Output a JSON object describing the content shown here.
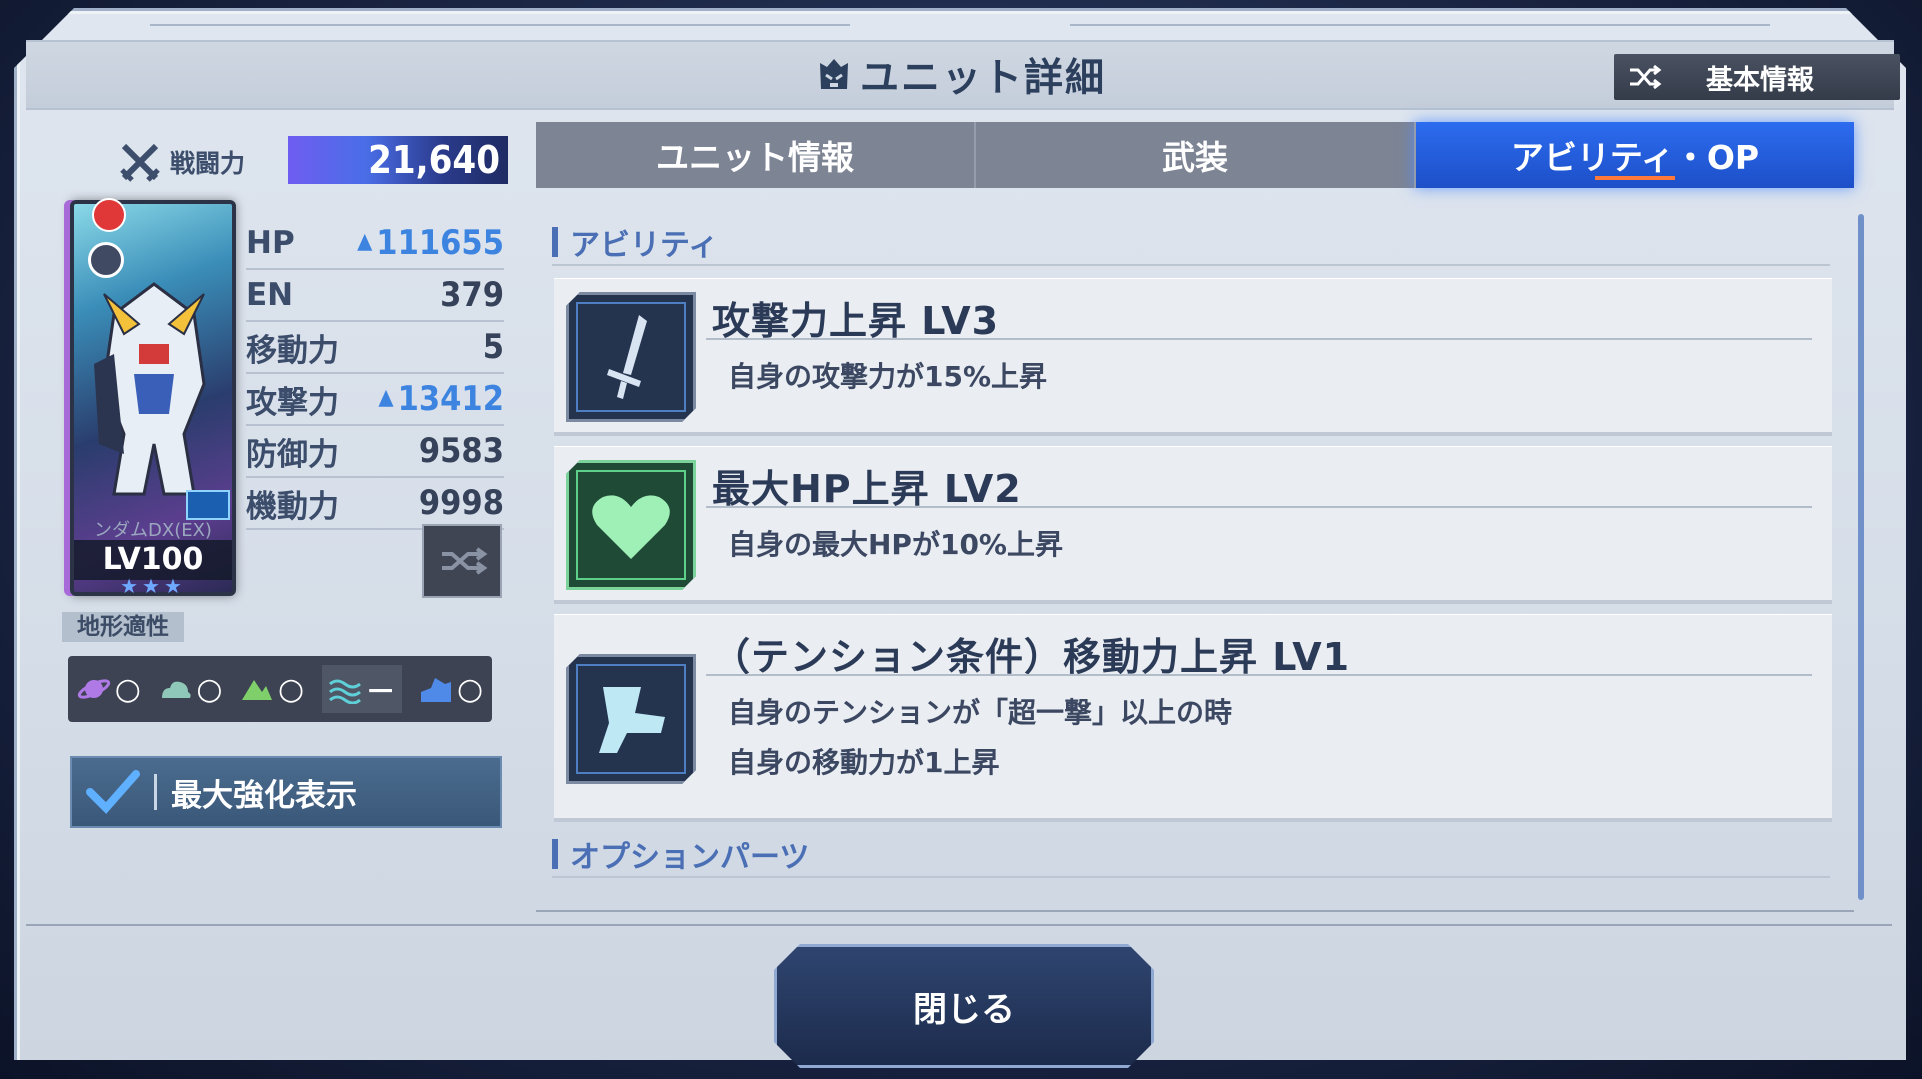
{
  "header": {
    "title": "ユニット詳細",
    "basic_info_button": "基本情報"
  },
  "left_panel": {
    "power_label": "戦闘力",
    "power_value": "21,640",
    "card": {
      "name": "ンダムDX(EX)",
      "level": "LV100",
      "stars": "★★★"
    },
    "stats": [
      {
        "label": "HP",
        "value": "111655",
        "boosted": true
      },
      {
        "label": "EN",
        "value": "379",
        "boosted": false
      },
      {
        "label": "移動力",
        "value": "5",
        "boosted": false
      },
      {
        "label": "攻撃力",
        "value": "13412",
        "boosted": true
      },
      {
        "label": "防御力",
        "value": "9583",
        "boosted": false
      },
      {
        "label": "機動力",
        "value": "9998",
        "boosted": false
      }
    ],
    "terrain_label": "地形適性",
    "terrain": [
      {
        "icon": "space-icon",
        "rating": "○"
      },
      {
        "icon": "air-icon",
        "rating": "○"
      },
      {
        "icon": "land-icon",
        "rating": "○"
      },
      {
        "icon": "water-icon",
        "rating": "－"
      },
      {
        "icon": "underground-icon",
        "rating": "○"
      }
    ],
    "max_enhance_label": "最大強化表示",
    "max_enhance_checked": true
  },
  "tabs": [
    {
      "label": "ユニット情報",
      "active": false
    },
    {
      "label": "武装",
      "active": false
    },
    {
      "label": "アビリティ・OP",
      "active": true
    }
  ],
  "abilities_section": "アビリティ",
  "abilities": [
    {
      "icon": "sword-icon",
      "name": "攻撃力上昇 LV3",
      "desc": [
        "自身の攻撃力が15%上昇"
      ]
    },
    {
      "icon": "heart-icon",
      "name": "最大HP上昇 LV2",
      "desc": [
        "自身の最大HPが10%上昇"
      ]
    },
    {
      "icon": "boot-icon",
      "name": "（テンション条件）移動力上昇 LV1",
      "desc": [
        "自身のテンションが「超一撃」以上の時",
        "自身の移動力が1上昇"
      ]
    }
  ],
  "options_section": "オプションパーツ",
  "close_button": "閉じる",
  "colors": {
    "accent": "#2c6cef",
    "title": "#2c3f5d",
    "section": "#4b6fb5",
    "tab_underline": "#ff7a3a"
  }
}
